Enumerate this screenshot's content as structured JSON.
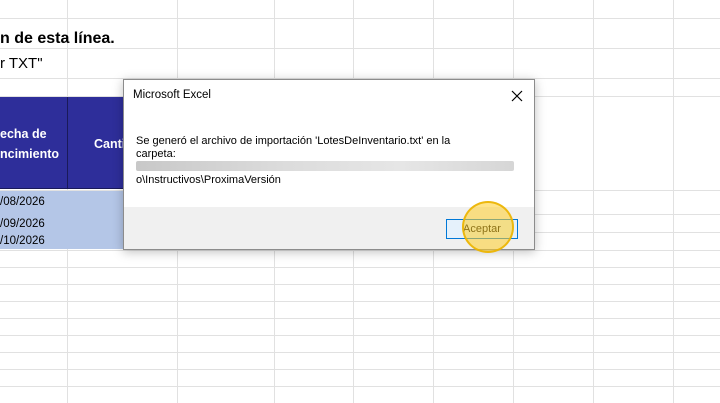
{
  "sheet": {
    "heading_line1": "n de esta línea.",
    "heading_line2": "r TXT\"",
    "header": {
      "col1_line1": "echa de",
      "col1_line2": "ncimiento",
      "col2": "Canti"
    },
    "dates": [
      "/08/2026",
      "/09/2026",
      "/10/2026"
    ]
  },
  "dialog": {
    "title": "Microsoft Excel",
    "message_line1": "Se generó el archivo de importación 'LotesDeInventario.txt' en la",
    "message_line2": "carpeta:",
    "message_path": "o\\Instructivos\\ProximaVersión",
    "ok_button": "Aceptar",
    "close_icon": "close-icon"
  },
  "colors": {
    "header_bg": "#2e2e9a",
    "data_band": "#b4c6e7",
    "button_border": "#0078d7",
    "click_highlight": "#ffcd28"
  }
}
